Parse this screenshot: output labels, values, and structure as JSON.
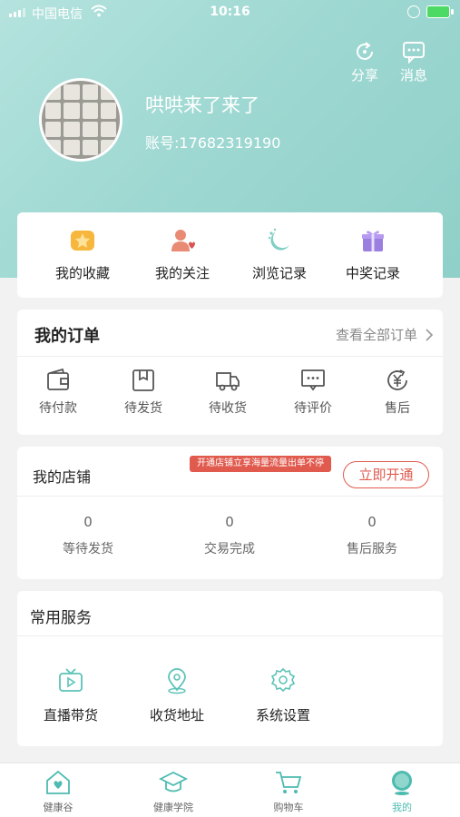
{
  "status_bar": {
    "carrier": "中国电信",
    "time": "10:16"
  },
  "header": {
    "share_label": "分享",
    "message_label": "消息",
    "username": "哄哄来了来了",
    "account": "账号:17682319190"
  },
  "quick_links": [
    {
      "label": "我的收藏",
      "icon": "star-icon"
    },
    {
      "label": "我的关注",
      "icon": "follow-icon"
    },
    {
      "label": "浏览记录",
      "icon": "history-icon"
    },
    {
      "label": "中奖记录",
      "icon": "gift-icon"
    }
  ],
  "orders": {
    "title": "我的订单",
    "view_all": "查看全部订单",
    "items": [
      {
        "label": "待付款",
        "icon": "wallet-icon"
      },
      {
        "label": "待发货",
        "icon": "box-icon"
      },
      {
        "label": "待收货",
        "icon": "truck-icon"
      },
      {
        "label": "待评价",
        "icon": "comment-icon"
      },
      {
        "label": "售后",
        "icon": "yen-refund-icon"
      }
    ]
  },
  "shop": {
    "title": "我的店铺",
    "promo": "开通店铺立享海量流量出单不停",
    "open_button": "立即开通",
    "stats": [
      {
        "value": "0",
        "label": "等待发货"
      },
      {
        "value": "0",
        "label": "交易完成"
      },
      {
        "value": "0",
        "label": "售后服务"
      }
    ]
  },
  "services": {
    "title": "常用服务",
    "items": [
      {
        "label": "直播带货",
        "icon": "tv-icon"
      },
      {
        "label": "收货地址",
        "icon": "location-icon"
      },
      {
        "label": "系统设置",
        "icon": "gear-icon"
      }
    ]
  },
  "tabbar": [
    {
      "label": "健康谷",
      "icon": "home-heart-icon"
    },
    {
      "label": "健康学院",
      "icon": "graduation-cap-icon"
    },
    {
      "label": "购物车",
      "icon": "cart-icon"
    },
    {
      "label": "我的",
      "icon": "profile-icon",
      "active": true
    }
  ],
  "colors": {
    "accent": "#4dbbb0",
    "hero": "#9fd8d2",
    "promo": "#e05a4e"
  }
}
